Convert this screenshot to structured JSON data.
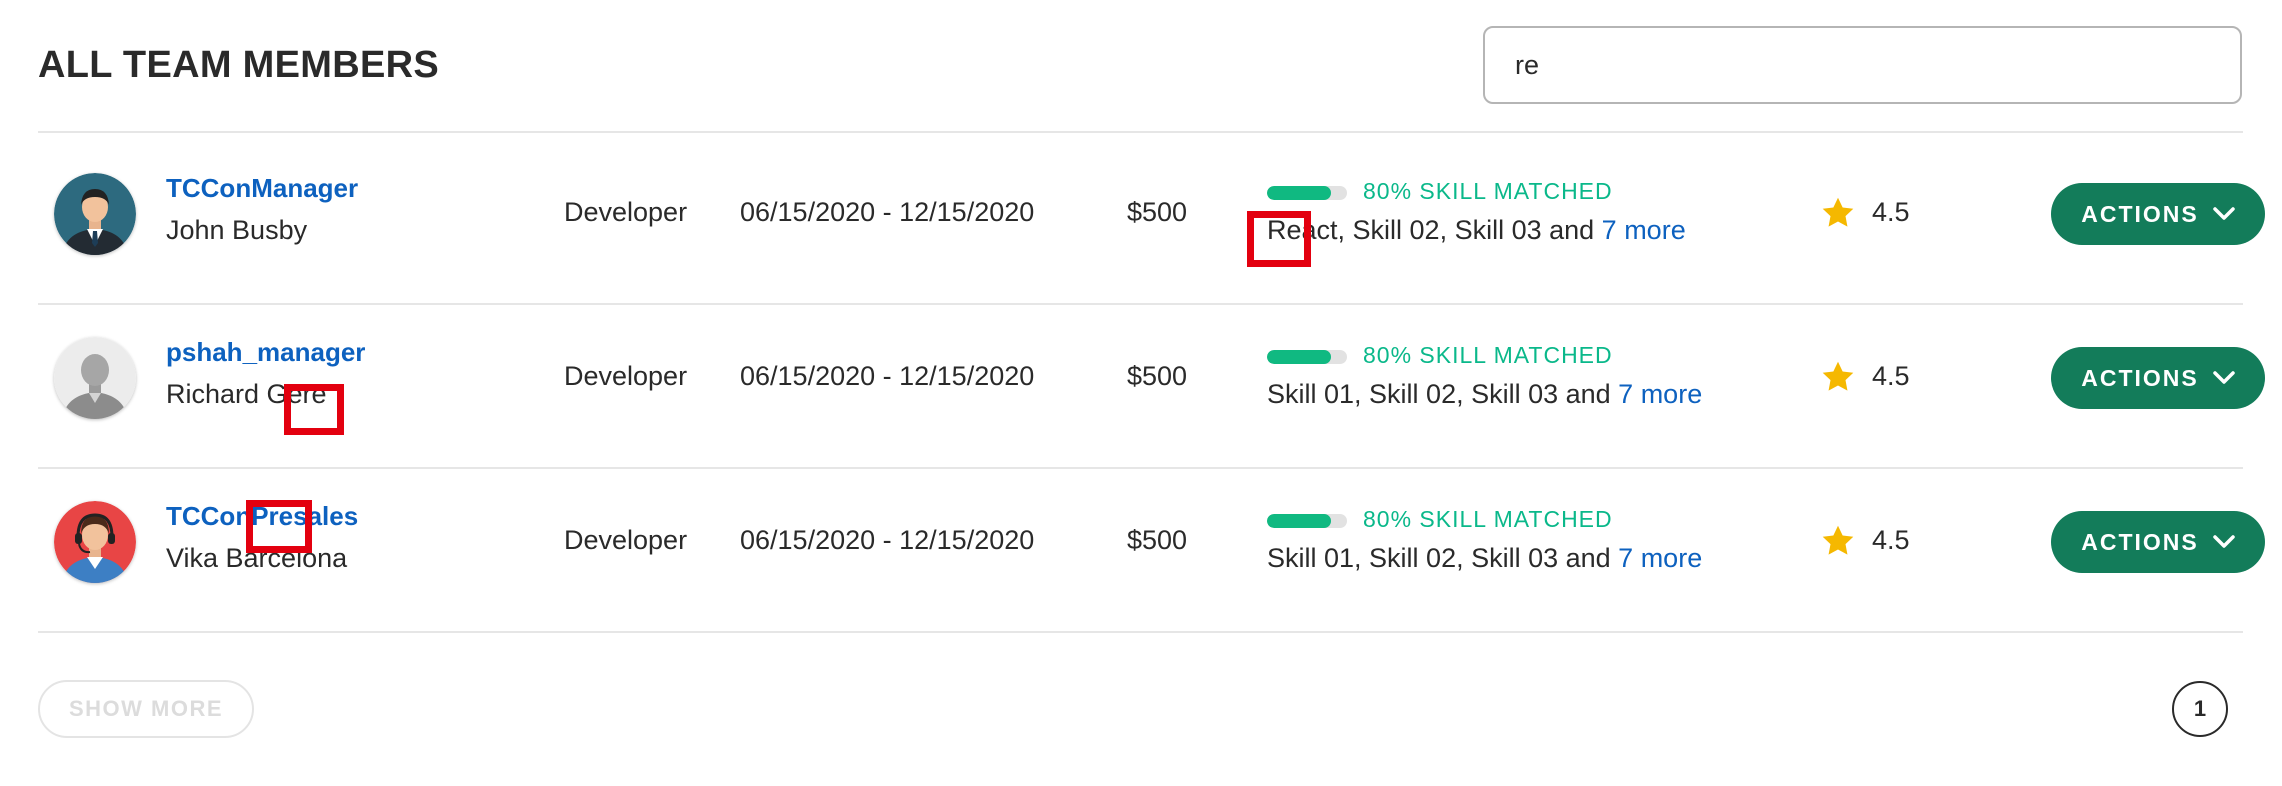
{
  "header": {
    "title": "ALL TEAM MEMBERS"
  },
  "search": {
    "value": "re"
  },
  "members": [
    {
      "handle": "TCConManager",
      "name": "John Busby",
      "role": "Developer",
      "dates": "06/15/2020 - 12/15/2020",
      "rate": "$500",
      "skill_match": "80% SKILL MATCHED",
      "skill_match_value": 0.8,
      "skills": "React, Skill 02, Skill 03 and ",
      "more": "7 more",
      "rating": "4.5",
      "actions_label": "ACTIONS",
      "avatar_icon": "man-in-suit-avatar-icon",
      "avatar_bg": "#2d6a7f"
    },
    {
      "handle": "pshah_manager",
      "name": "Richard Gere",
      "role": "Developer",
      "dates": "06/15/2020 - 12/15/2020",
      "rate": "$500",
      "skill_match": "80% SKILL MATCHED",
      "skill_match_value": 0.8,
      "skills": "Skill 01, Skill 02, Skill 03 and ",
      "more": "7 more",
      "rating": "4.5",
      "actions_label": "ACTIONS",
      "avatar_icon": "default-person-avatar-icon",
      "avatar_bg": "#ececec"
    },
    {
      "handle": "TCConPresales",
      "name": "Vika Barcelona",
      "role": "Developer",
      "dates": "06/15/2020 - 12/15/2020",
      "rate": "$500",
      "skill_match": "80% SKILL MATCHED",
      "skill_match_value": 0.8,
      "skills": "Skill 01, Skill 02, Skill 03 and ",
      "more": "7 more",
      "rating": "4.5",
      "actions_label": "ACTIONS",
      "avatar_icon": "headset-operator-avatar-icon",
      "avatar_bg": "#e84545"
    }
  ],
  "footer": {
    "show_more": "SHOW MORE",
    "page": "1"
  },
  "colors": {
    "accent": "#137c5a",
    "link": "#0d61bf",
    "match": "#0ab88a",
    "star": "#f5b800",
    "highlight": "#e3000f"
  }
}
